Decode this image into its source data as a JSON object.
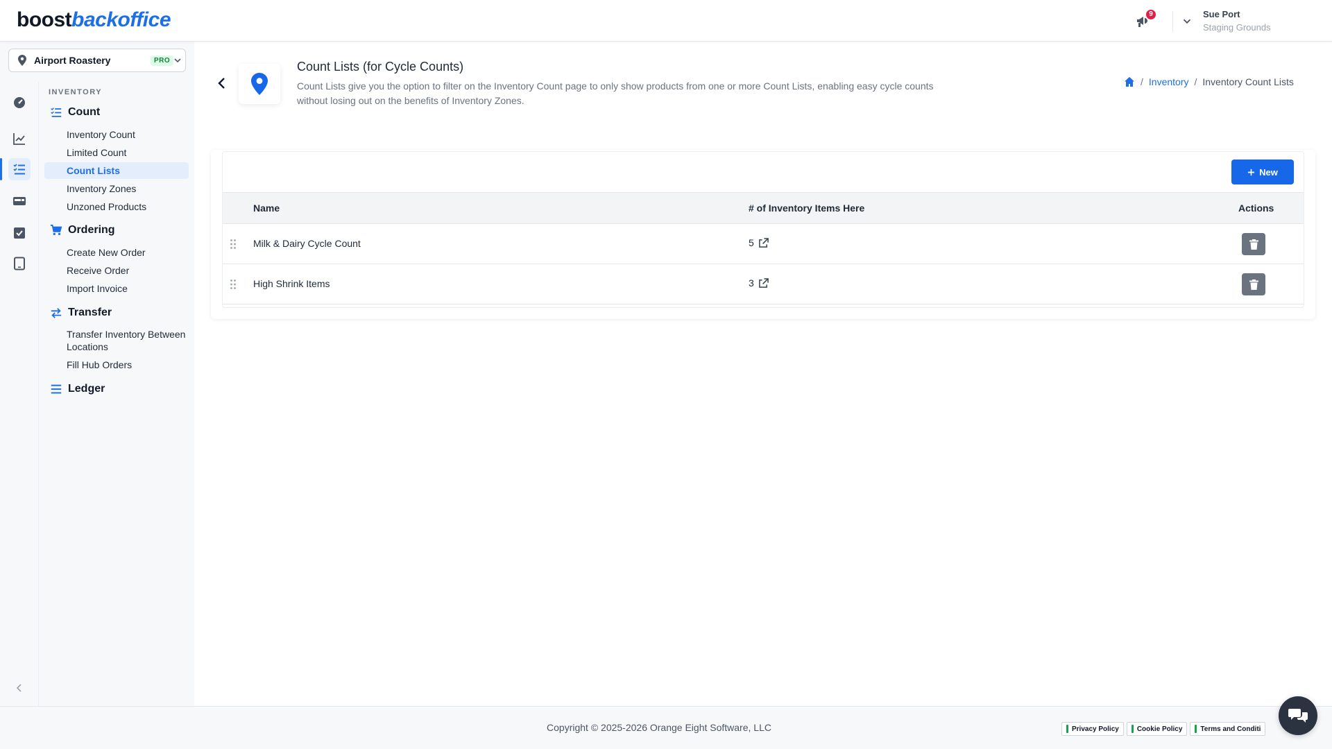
{
  "header": {
    "logo_part1": "boost",
    "logo_part2": "backoffice",
    "notification_count": "9",
    "user_name": "Sue Port",
    "user_org": "Staging Grounds"
  },
  "location": {
    "name": "Airport Roastery",
    "tier": "PRO"
  },
  "rail": {
    "icons": [
      "dashboard-icon",
      "chart-line-icon",
      "checklist-icon",
      "card-icon",
      "checkbox-icon",
      "tablet-icon"
    ],
    "active_index": 2
  },
  "nav": {
    "caption": "INVENTORY",
    "groups": [
      {
        "label": "Count",
        "icon": "checklist-icon",
        "items": [
          "Inventory Count",
          "Limited Count",
          "Count Lists",
          "Inventory Zones",
          "Unzoned Products"
        ]
      },
      {
        "label": "Ordering",
        "icon": "cart-icon",
        "items": [
          "Create New Order",
          "Receive Order",
          "Import Invoice"
        ]
      },
      {
        "label": "Transfer",
        "icon": "transfer-icon",
        "items": [
          "Transfer Inventory Between Locations",
          "Fill Hub Orders"
        ]
      },
      {
        "label": "Ledger",
        "icon": "list-icon",
        "items": []
      }
    ],
    "active_item": "Count Lists"
  },
  "page": {
    "title": "Count Lists (for Cycle Counts)",
    "description": "Count Lists give you the option to filter on the Inventory Count page to only show products from one or more Count Lists, enabling easy cycle counts without losing out on the benefits of Inventory Zones.",
    "breadcrumb": {
      "sep": "/",
      "link": "Inventory",
      "current": "Inventory Count Lists"
    }
  },
  "table": {
    "new_label": "New",
    "headers": {
      "name": "Name",
      "count": "# of Inventory Items Here",
      "actions": "Actions"
    },
    "rows": [
      {
        "name": "Milk & Dairy Cycle Count",
        "count": "5"
      },
      {
        "name": "High Shrink Items",
        "count": "3"
      }
    ]
  },
  "footer": {
    "copyright": "Copyright © 2025-2026 Orange Eight Software, LLC",
    "policies": [
      "Privacy Policy",
      "Cookie Policy",
      "Terms and Conditi"
    ]
  },
  "colors": {
    "brand_blue": "#1d6fe8",
    "active_bg": "#e3edfc",
    "badge_red": "#e11d48",
    "delete_gray": "#6b7280"
  }
}
